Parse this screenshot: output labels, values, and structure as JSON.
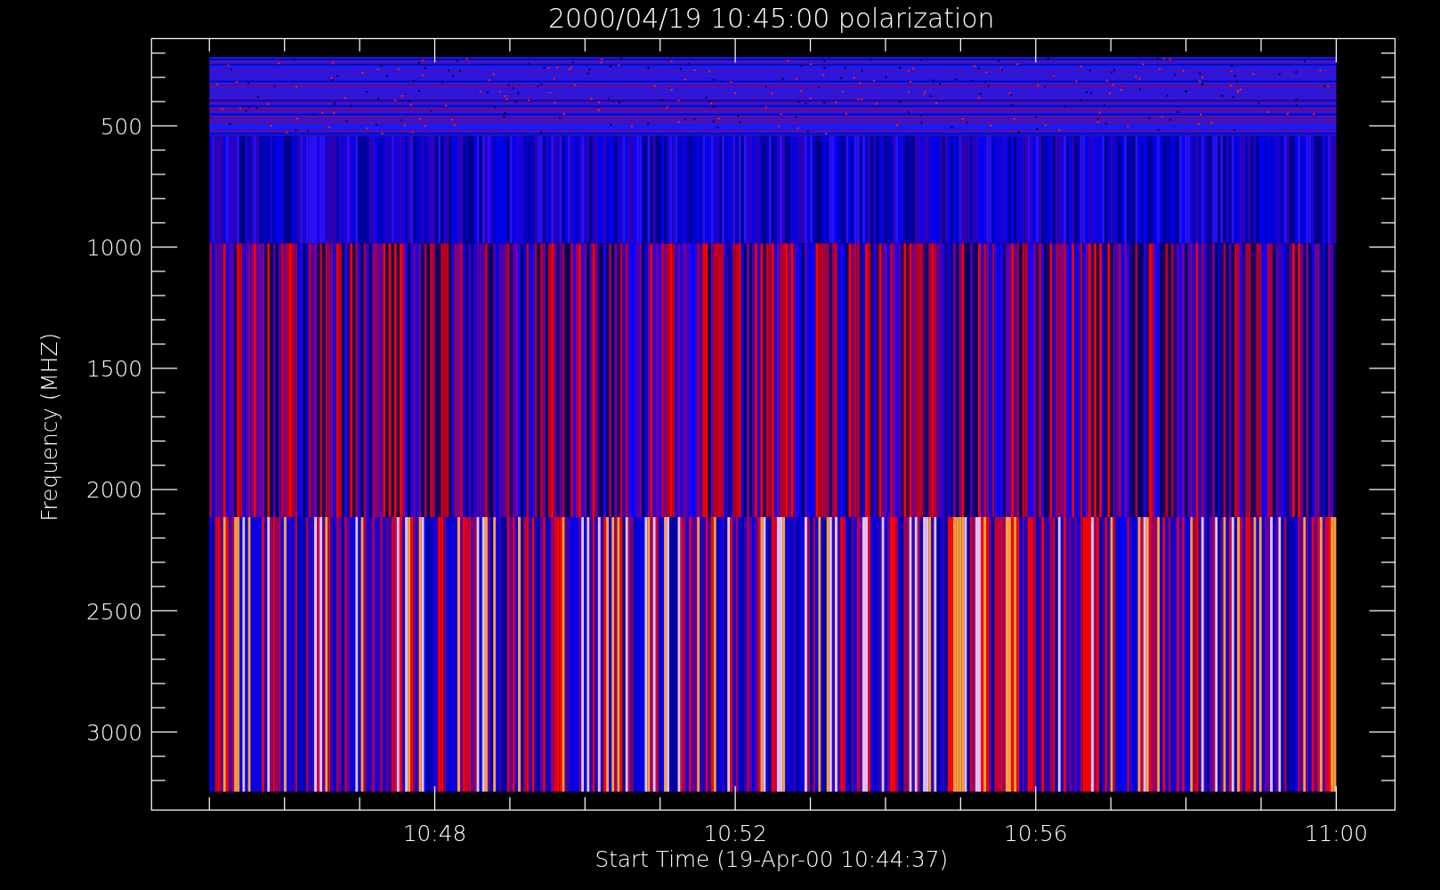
{
  "title": "2000/04/19 10:45:00 polarization",
  "xlabel": "Start Time (19-Apr-00 10:44:37)",
  "ylabel": "Frequency (MHZ)",
  "yticks": [
    "500",
    "1000",
    "1500",
    "2000",
    "2500",
    "3000"
  ],
  "xticks": [
    "10:48",
    "10:52",
    "10:56",
    "11:00"
  ]
}
